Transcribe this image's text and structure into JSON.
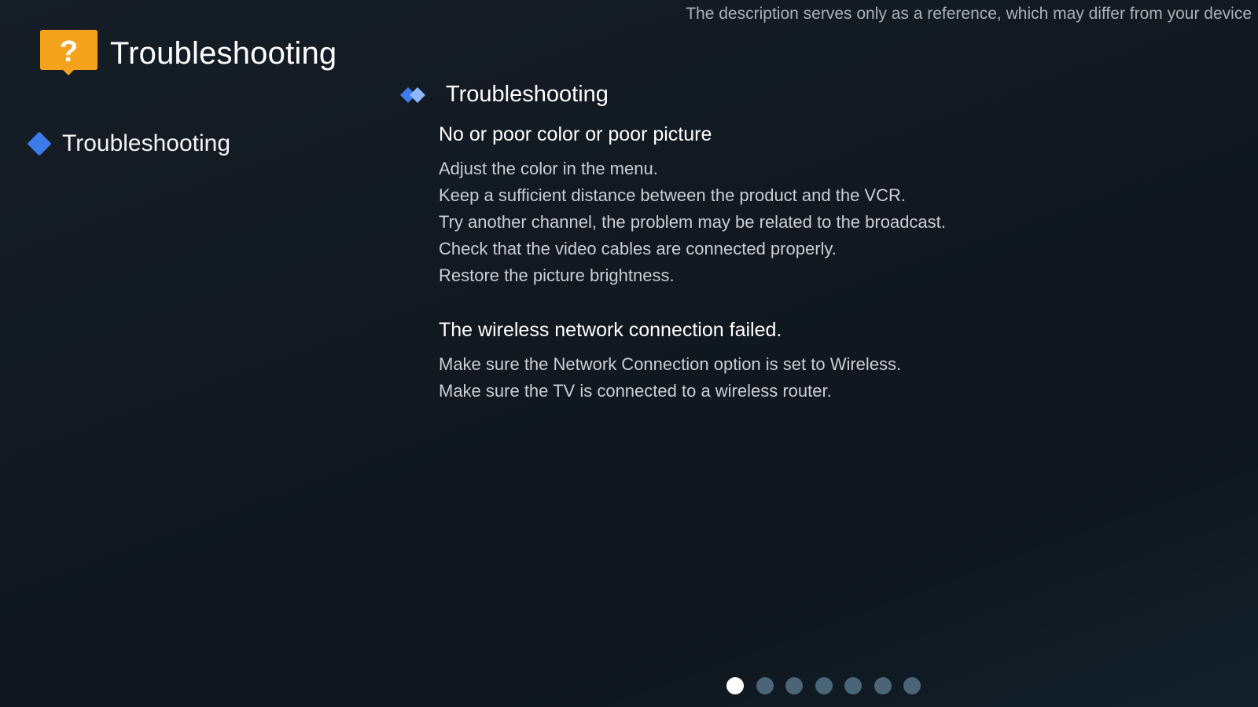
{
  "disclaimer": "The description serves only as a reference, which may differ from your device",
  "header": {
    "icon": "help-bubble-icon",
    "icon_color": "#f5a31c",
    "title": "Troubleshooting"
  },
  "left_nav": {
    "items": [
      {
        "label": "Troubleshooting",
        "icon": "diamond-bullet-icon",
        "color": "#3d7bea"
      }
    ]
  },
  "content": {
    "section_icon": "double-diamond-icon",
    "section_title": "Troubleshooting",
    "topics": [
      {
        "heading": "No or poor color or poor picture",
        "lines": [
          "Adjust the color in the menu.",
          "Keep a sufficient distance between the product and the VCR.",
          "Try another channel, the problem may be related to the broadcast.",
          "Check that the video cables are connected properly.",
          "Restore the picture brightness."
        ]
      },
      {
        "heading": "The wireless network connection failed.",
        "lines": [
          "Make sure the Network Connection option is set to Wireless.",
          "Make sure the TV is connected to a wireless router."
        ]
      }
    ]
  },
  "pager": {
    "total": 7,
    "current": 1
  }
}
